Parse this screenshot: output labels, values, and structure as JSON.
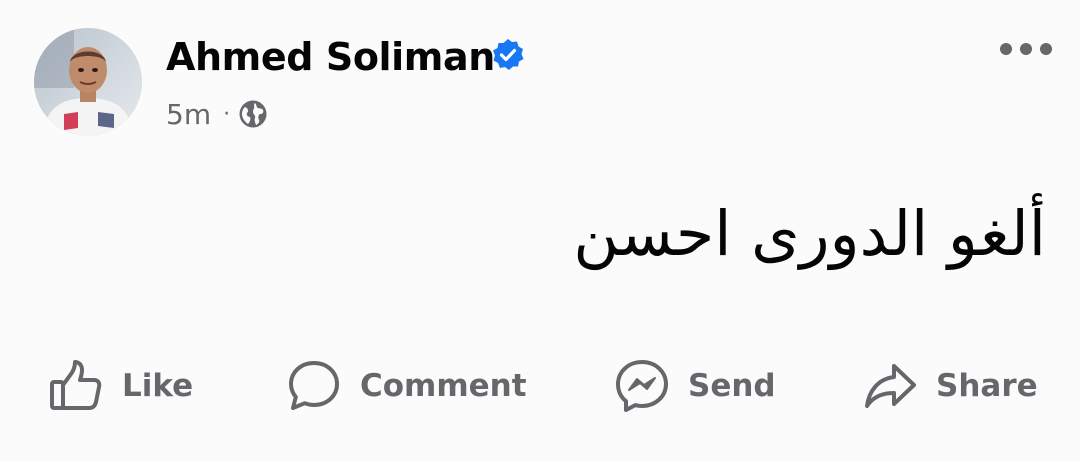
{
  "post": {
    "author": {
      "name": "Ahmed Soliman",
      "verified": true,
      "avatar": "profile-photo"
    },
    "meta": {
      "time": "5m",
      "separator": "·",
      "audience_icon": "globe-icon"
    },
    "text": "ألغو الدورى احسن",
    "more_icon": "more-horizontal-icon"
  },
  "actions": {
    "like": {
      "label": "Like",
      "icon": "thumbs-up-icon"
    },
    "comment": {
      "label": "Comment",
      "icon": "comment-bubble-icon"
    },
    "send": {
      "label": "Send",
      "icon": "messenger-icon"
    },
    "share": {
      "label": "Share",
      "icon": "share-arrow-icon"
    }
  },
  "colors": {
    "background": "#fcfbfc",
    "text_primary": "#050505",
    "text_secondary": "#65676b",
    "verified_blue": "#1877f2"
  }
}
